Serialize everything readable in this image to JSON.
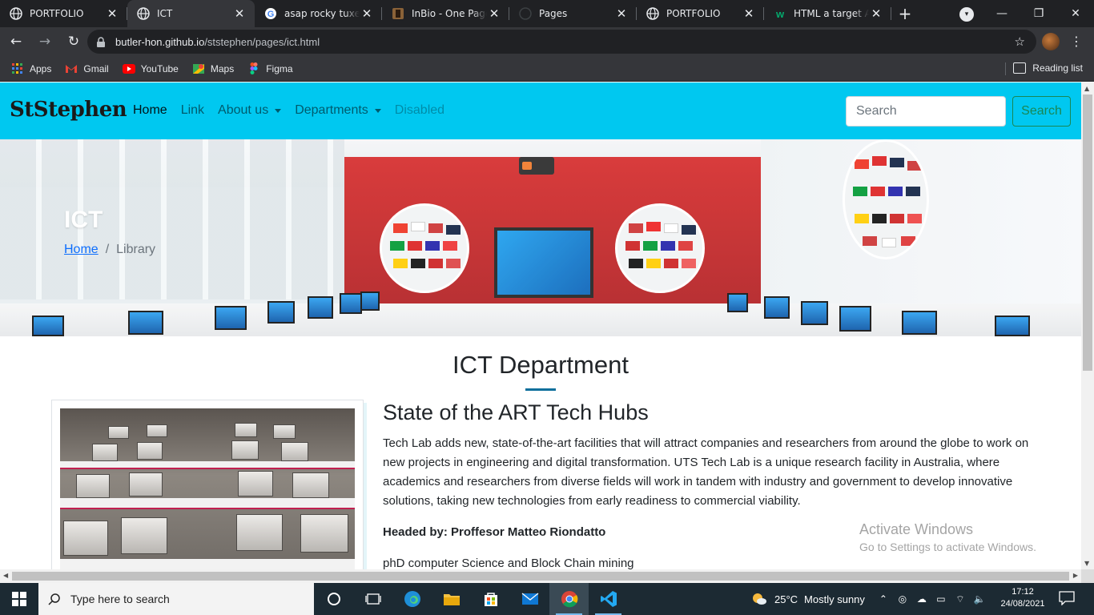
{
  "browser": {
    "tabs": [
      {
        "title": "PORTFOLIO",
        "icon": "globe-icon",
        "active": false
      },
      {
        "title": "ICT",
        "icon": "globe-icon",
        "active": true
      },
      {
        "title": "asap rocky tuxedo",
        "icon": "google-icon",
        "active": false
      },
      {
        "title": "InBio - One Page",
        "icon": "inbio-icon",
        "active": false
      },
      {
        "title": "Pages",
        "icon": "github-icon",
        "active": false
      },
      {
        "title": "PORTFOLIO",
        "icon": "globe-icon",
        "active": false
      },
      {
        "title": "HTML a target At",
        "icon": "w3-icon",
        "active": false
      }
    ],
    "new_tab": "+",
    "window_controls": {
      "minimize": "—",
      "restore": "❐",
      "close": "✕"
    },
    "url_host": "butler-hon.github.io",
    "url_path": "/ststephen/pages/ict.html",
    "bookmarks": [
      {
        "label": "Apps",
        "icon": "apps-grid-icon"
      },
      {
        "label": "Gmail",
        "icon": "gmail-icon"
      },
      {
        "label": "YouTube",
        "icon": "youtube-icon"
      },
      {
        "label": "Maps",
        "icon": "maps-icon"
      },
      {
        "label": "Figma",
        "icon": "figma-icon"
      }
    ],
    "reading_list": "Reading list"
  },
  "site": {
    "brand": "StStephen",
    "nav": {
      "home": "Home",
      "link": "Link",
      "about": "About us",
      "departments": "Departments",
      "disabled": "Disabled"
    },
    "search_placeholder": "Search",
    "search_button": "Search",
    "colors": {
      "navbar": "#00c8f0",
      "accent_line": "#0e6f9c",
      "search_btn": "#198754"
    }
  },
  "hero": {
    "title": "ICT",
    "breadcrumb_home": "Home",
    "breadcrumb_sep": "/",
    "breadcrumb_current": "Library"
  },
  "content": {
    "heading": "ICT Department",
    "subheading": "State of the ART Tech Hubs",
    "paragraph": "Tech Lab adds new, state-of-the-art facilities that will attract companies and researchers from around the globe to work on new projects in engineering and digital transformation. UTS Tech Lab is a unique research facility in Australia, where academics and researchers from diverse fields will work in tandem with industry and government to develop innovative solutions, taking new technologies from early readiness to commercial viability.",
    "headed_by": "Headed by: Proffesor Matteo Riondatto",
    "qualification": "phD computer Science and Block Chain mining"
  },
  "watermark": {
    "line1": "Activate Windows",
    "line2": "Go to Settings to activate Windows."
  },
  "taskbar": {
    "search_placeholder": "Type here to search",
    "apps": [
      "cortana-icon",
      "task-view-icon",
      "edge-icon",
      "file-explorer-icon",
      "store-icon",
      "mail-icon",
      "chrome-icon",
      "vscode-icon"
    ],
    "weather_temp": "25°C",
    "weather_text": "Mostly sunny",
    "time": "17:12",
    "date": "24/08/2021"
  }
}
